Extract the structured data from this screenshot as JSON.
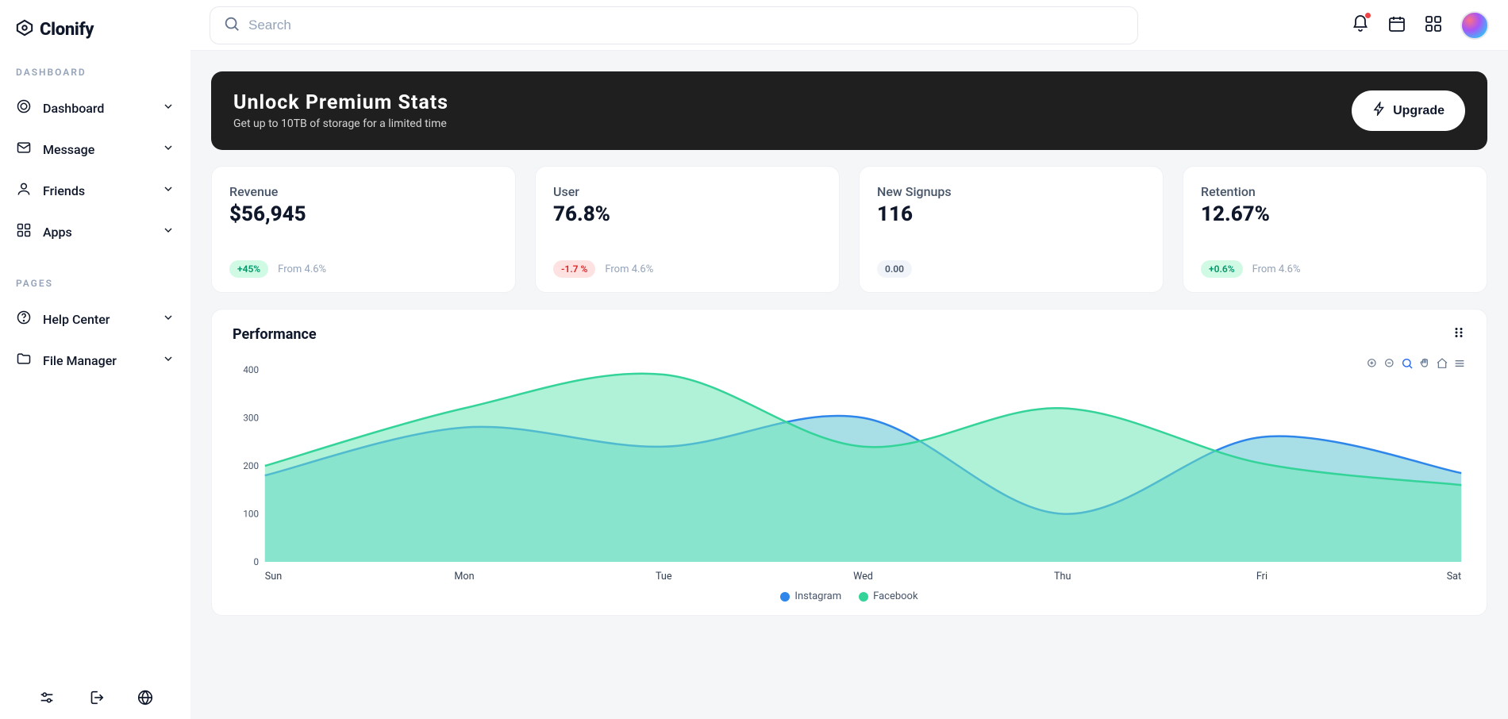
{
  "brand": {
    "name": "Clonify"
  },
  "search": {
    "placeholder": "Search"
  },
  "sidebar": {
    "section_dashboard": "DASHBOARD",
    "section_pages": "PAGES",
    "items_dash": [
      {
        "label": "Dashboard"
      },
      {
        "label": "Message"
      },
      {
        "label": "Friends"
      },
      {
        "label": "Apps"
      }
    ],
    "items_pages": [
      {
        "label": "Help Center"
      },
      {
        "label": "File Manager"
      }
    ]
  },
  "banner": {
    "title": "Unlock Premium Stats",
    "subtitle": "Get up to 10TB of storage for a limited time",
    "cta": "Upgrade"
  },
  "stats": [
    {
      "label": "Revenue",
      "value": "$56,945",
      "pill": "+45%",
      "pill_class": "pill-green",
      "from": "From 4.6%"
    },
    {
      "label": "User",
      "value": "76.8%",
      "pill": "-1.7 %",
      "pill_class": "pill-red",
      "from": "From 4.6%"
    },
    {
      "label": "New Signups",
      "value": "116",
      "pill": "0.00",
      "pill_class": "pill-gray",
      "from": ""
    },
    {
      "label": "Retention",
      "value": "12.67%",
      "pill": "+0.6%",
      "pill_class": "pill-green",
      "from": "From 4.6%"
    }
  ],
  "perf": {
    "title": "Performance"
  },
  "chart_data": {
    "type": "area",
    "title": "Performance",
    "xlabel": "",
    "ylabel": "",
    "ylim": [
      0,
      400
    ],
    "yticks": [
      0,
      100,
      200,
      300,
      400
    ],
    "categories": [
      "Sun",
      "Mon",
      "Tue",
      "Wed",
      "Thu",
      "Fri",
      "Sat"
    ],
    "series": [
      {
        "name": "Instagram",
        "color": "#2e86eb",
        "fill": "rgba(96,197,210,0.55)",
        "values": [
          180,
          280,
          240,
          300,
          100,
          260,
          185
        ]
      },
      {
        "name": "Facebook",
        "color": "#34d399",
        "fill": "rgba(110,231,183,0.55)",
        "values": [
          200,
          320,
          390,
          240,
          320,
          205,
          160
        ]
      }
    ],
    "legend_position": "bottom",
    "grid": false
  }
}
